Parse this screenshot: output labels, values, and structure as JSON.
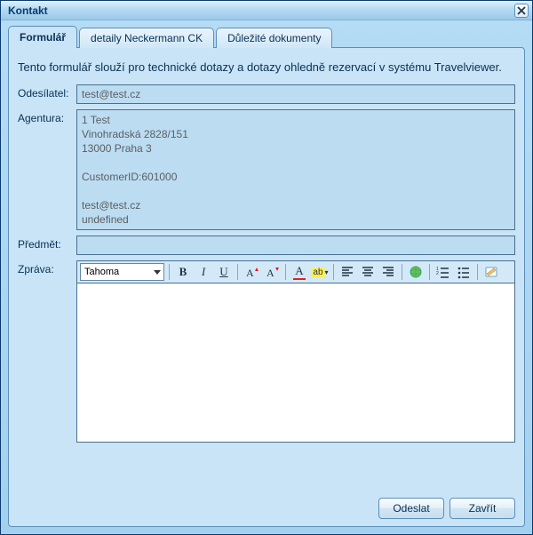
{
  "window": {
    "title": "Kontakt"
  },
  "tabs": [
    {
      "label": "Formulář",
      "active": true
    },
    {
      "label": "detaily Neckermann CK",
      "active": false
    },
    {
      "label": "Důležité dokumenty",
      "active": false
    }
  ],
  "intro": "Tento formulář slouží pro technické dotazy a dotazy ohledně rezervací v systému Travelviewer.",
  "labels": {
    "sender": "Odesílatel:",
    "agency": "Agentura:",
    "subject": "Předmět:",
    "message": "Zpráva:"
  },
  "values": {
    "sender": "test@test.cz",
    "agency": "1 Test\nVinohradská 2828/151\n13000 Praha 3\n\nCustomerID:601000\n\ntest@test.cz\nundefined",
    "subject": "",
    "message": ""
  },
  "toolbar": {
    "font_name": "Tahoma",
    "bold": "B",
    "italic": "I",
    "underline": "U",
    "grow": "A",
    "shrink": "A",
    "forecolor": "A",
    "highlight": "ab"
  },
  "buttons": {
    "send": "Odeslat",
    "close": "Zavřít"
  }
}
